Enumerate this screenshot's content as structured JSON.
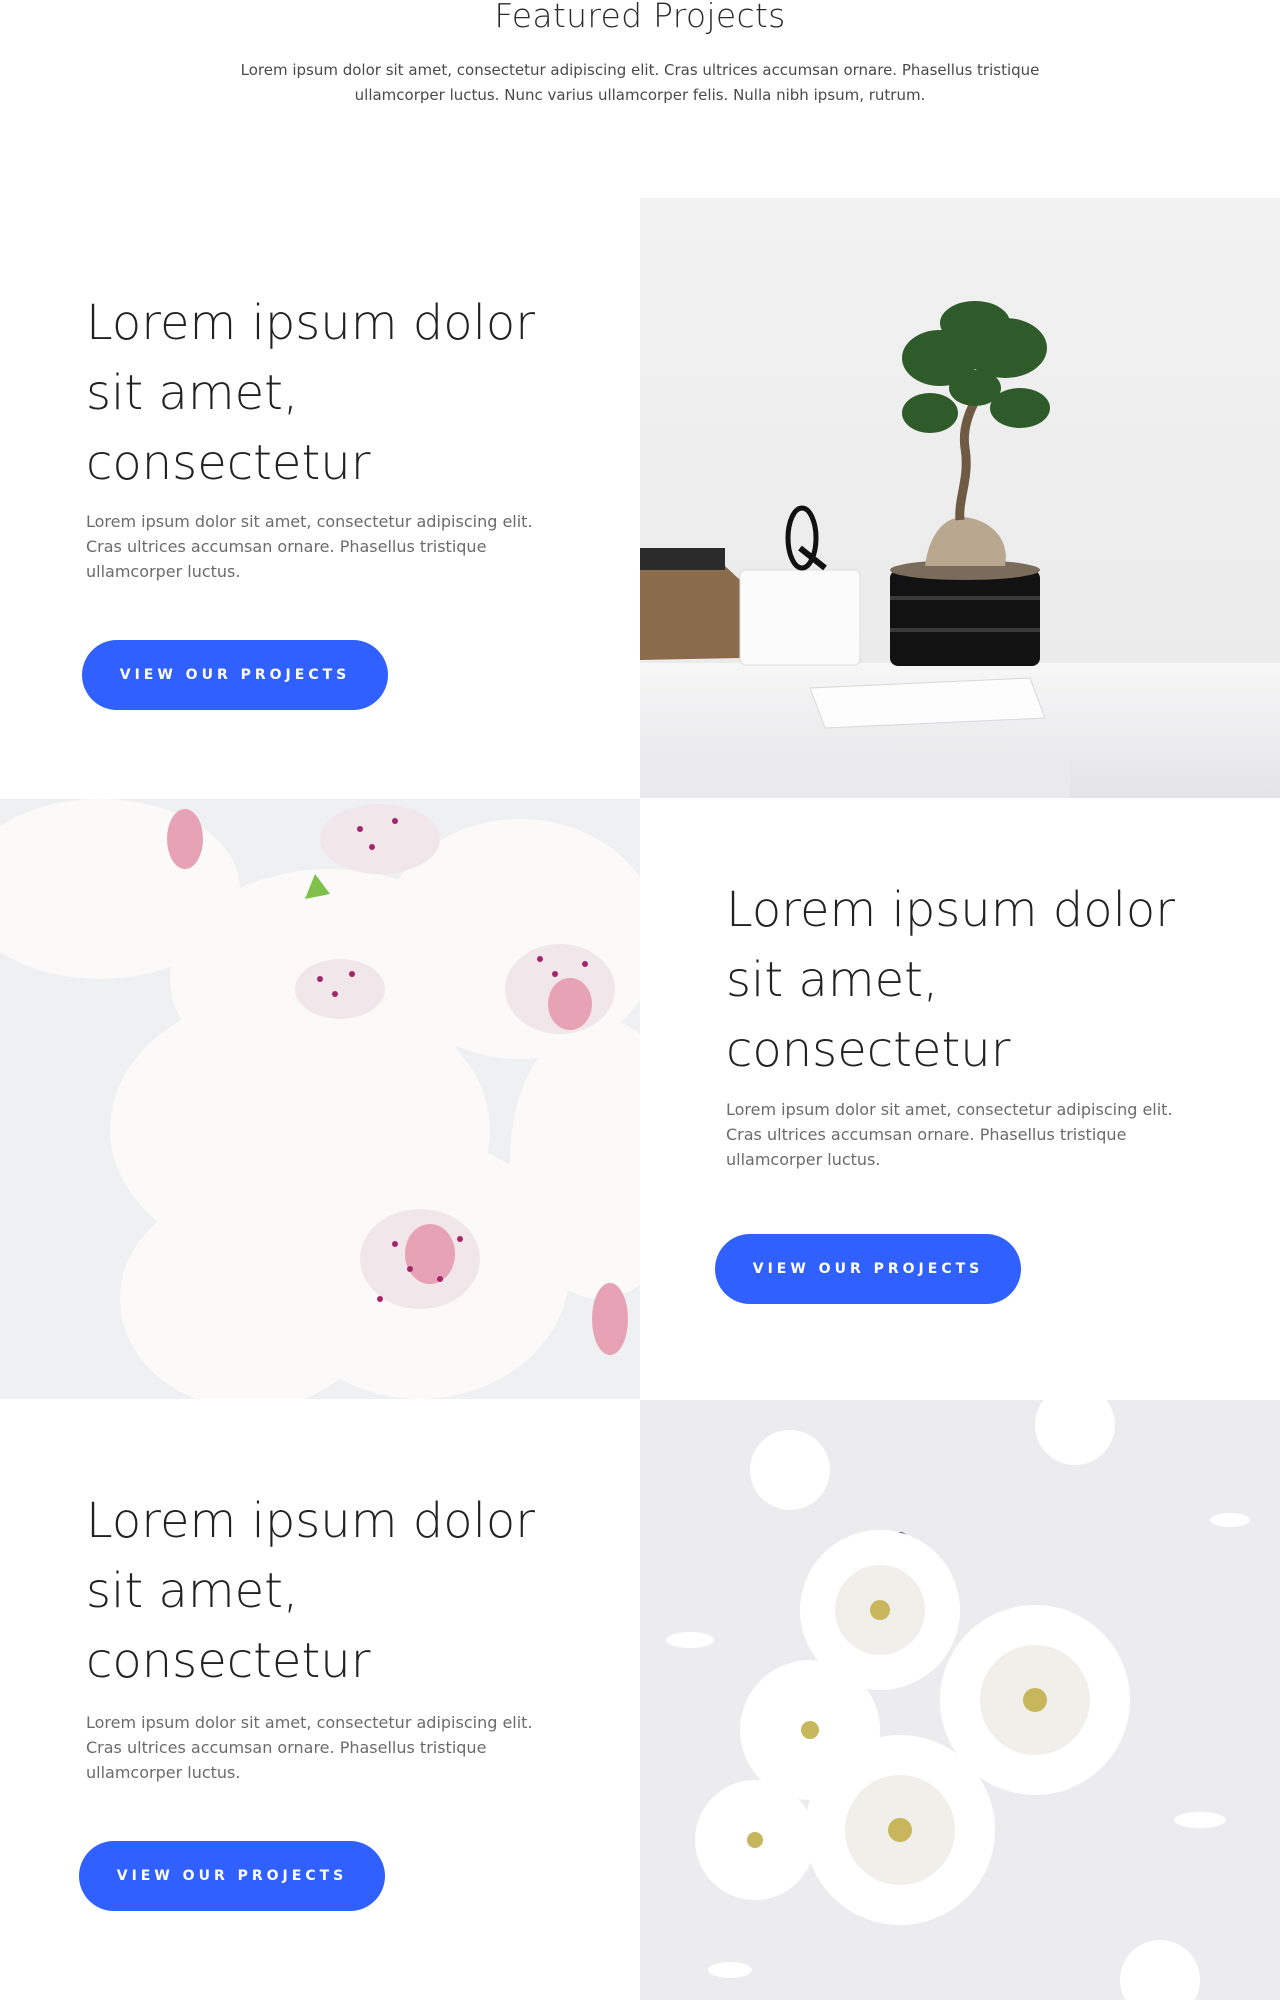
{
  "header": {
    "title": "Featured Projects",
    "description": "Lorem ipsum dolor sit amet, consectetur adipiscing elit. Cras ultrices accumsan ornare. Phasellus tristique ullamcorper luctus. Nunc varius ullamcorper felis. Nulla nibh ipsum, rutrum."
  },
  "projects": [
    {
      "title": "Lorem ipsum dolor sit amet, consectetur",
      "description": "Lorem ipsum dolor sit amet, consectetur adipiscing elit. Cras ultrices accumsan ornare. Phasellus tristique ullamcorper luctus.",
      "button_label": "VIEW OUR PROJECTS",
      "image": "bonsai-desk-photo"
    },
    {
      "title": "Lorem ipsum dolor sit amet, consectetur",
      "description": "Lorem ipsum dolor sit amet, consectetur adipiscing elit. Cras ultrices accumsan ornare. Phasellus tristique ullamcorper luctus.",
      "button_label": "VIEW OUR PROJECTS",
      "image": "white-orchids-photo"
    },
    {
      "title": "Lorem ipsum dolor sit amet, consectetur",
      "description": "Lorem ipsum dolor sit amet, consectetur adipiscing elit. Cras ultrices accumsan ornare. Phasellus tristique ullamcorper luctus.",
      "button_label": "VIEW OUR PROJECTS",
      "image": "white-chrysanthemums-photo"
    }
  ],
  "colors": {
    "accent": "#3060ff",
    "heading": "#222222",
    "body_text": "#6b6b6b"
  }
}
